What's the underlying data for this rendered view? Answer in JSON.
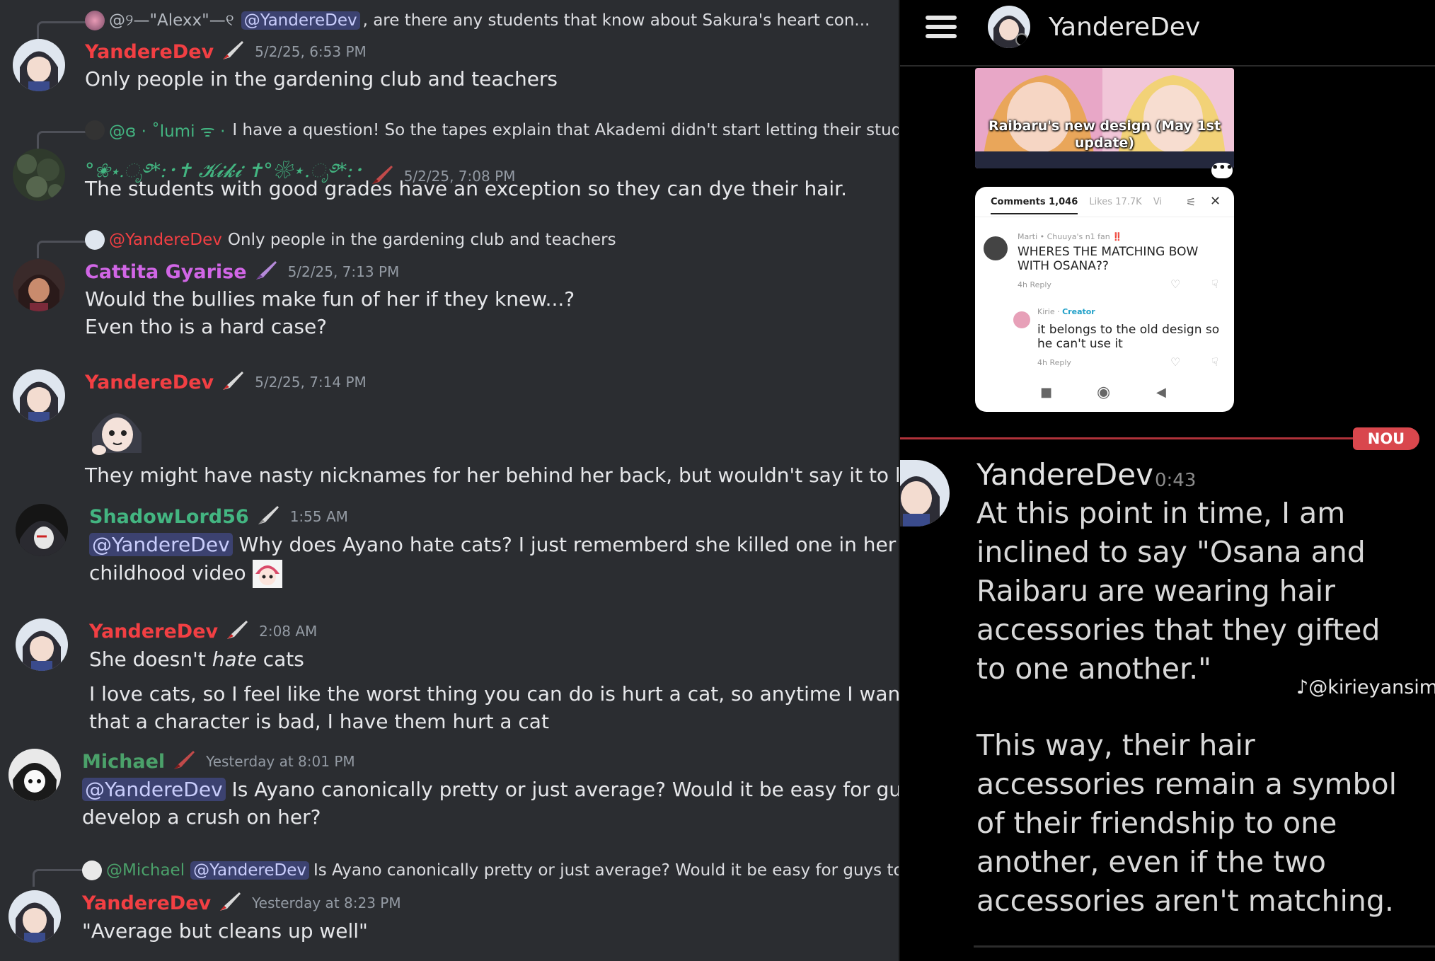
{
  "left_chat": {
    "messages": [
      {
        "reply": {
          "author": "@୨—\"Alexx\"—୧",
          "mention": "@YandereDev",
          "text": ", are there any students that know about Sakura's heart con..."
        },
        "author": "YandereDev",
        "author_color": "#f23f43",
        "timestamp": "5/2/25, 6:53 PM",
        "lines": [
          "Only people in the gardening club and teachers"
        ]
      },
      {
        "reply": {
          "author": "@ɞ · ˚lumi ᯤ ·",
          "text": "I have a question! So the tapes explain that Akademi didn't start letting their stud..."
        },
        "author": "°❀⋆.ೃ࿔*:･✝ 𝓚𝓲𝓴𝓲 ✝°❀⋆.ೃ࿔*:･",
        "author_color": "#43b581",
        "timestamp": "5/2/25, 7:08 PM",
        "lines": [
          "The students with good grades have an exception so they can dye their hair."
        ]
      },
      {
        "reply": {
          "author": "@YandereDev",
          "text": "Only people in the gardening club and teachers"
        },
        "author": "Cattita Gyarise",
        "author_color": "#d166e6",
        "timestamp": "5/2/25, 7:13 PM",
        "lines": [
          "Would the bullies make fun of her if they knew...?",
          "Even tho is a hard case?"
        ]
      },
      {
        "author": "YandereDev",
        "author_color": "#f23f43",
        "timestamp": "5/2/25, 7:14 PM",
        "lines": [
          "They might have nasty nicknames for her behind her back, but wouldn't say it to her face"
        ]
      },
      {
        "author": "ShadowLord56",
        "author_color": "#43b581",
        "timestamp": "1:55 AM",
        "mention": "@YandereDev",
        "lines": [
          "Why does Ayano hate cats? I just rememberd she killed one in her",
          "childhood video"
        ]
      },
      {
        "author": "YandereDev",
        "author_color": "#f23f43",
        "timestamp": "2:08 AM",
        "line1_pre": "She doesn't ",
        "line1_em": "hate",
        "line1_post": " cats",
        "lines": [
          "I love cats, so I feel like the worst thing you can do is hurt a cat, so anytime I want to show",
          "that a character is bad, I have them hurt a cat"
        ]
      },
      {
        "author": "Michael",
        "author_color": "#4ba16a",
        "timestamp": "Yesterday at 8:01 PM",
        "mention": "@YandereDev",
        "lines": [
          "Is Ayano canonically pretty or just average? Would it be easy for guys to",
          "develop a crush on her?"
        ]
      },
      {
        "reply": {
          "author": "@Michael",
          "mention": "@YandereDev",
          "text": "Is Ayano canonically pretty or just average? Would it be easy for guys to ..."
        },
        "author": "YandereDev",
        "author_color": "#f23f43",
        "timestamp": "Yesterday at 8:23 PM",
        "lines": [
          "\"Average but cleans up well\""
        ]
      }
    ]
  },
  "right_panel": {
    "header_name": "YandereDev",
    "thumb_caption": [
      "Raibaru's new design (May 1st",
      "update)"
    ],
    "more_label": "•••",
    "comments_card": {
      "tab_comments": "Comments 1,046",
      "tab_likes": "Likes 17.7K",
      "tab_more": "Vi",
      "c1_meta": "Marti • Chuuya's n1 fan ‼️",
      "c1_text": [
        "WHERES THE MATCHING BOW",
        "WITH OSANA??"
      ],
      "c1_foot": "4h     Reply",
      "c2_meta_name": "Kirie · ",
      "c2_meta_badge": "Creator",
      "c2_text": [
        "it belongs to the old design so",
        "he can't use it"
      ],
      "c2_foot": "4h     Reply",
      "nav": [
        "■",
        "◉",
        "◀"
      ]
    },
    "new_badge": "NOU",
    "message": {
      "author": "YandereDev",
      "timestamp": "0:43",
      "para1": [
        "At this point in time, I am",
        "inclined to say \"Osana and",
        "Raibaru are wearing hair",
        "accessories that they gifted",
        "to one another.\""
      ],
      "para2": [
        "This way, their hair",
        "accessories remain a symbol",
        "of their friendship to one",
        "another, even if the two",
        "accessories aren't matching."
      ]
    },
    "watermark": "@kirieyansim"
  },
  "colors": {
    "discord_bg": "#2b2d31",
    "mention_bg": "#3c4270",
    "red_name": "#f23f43",
    "green_name": "#43b581",
    "pink_name": "#d166e6",
    "new_line": "#b0323a"
  }
}
